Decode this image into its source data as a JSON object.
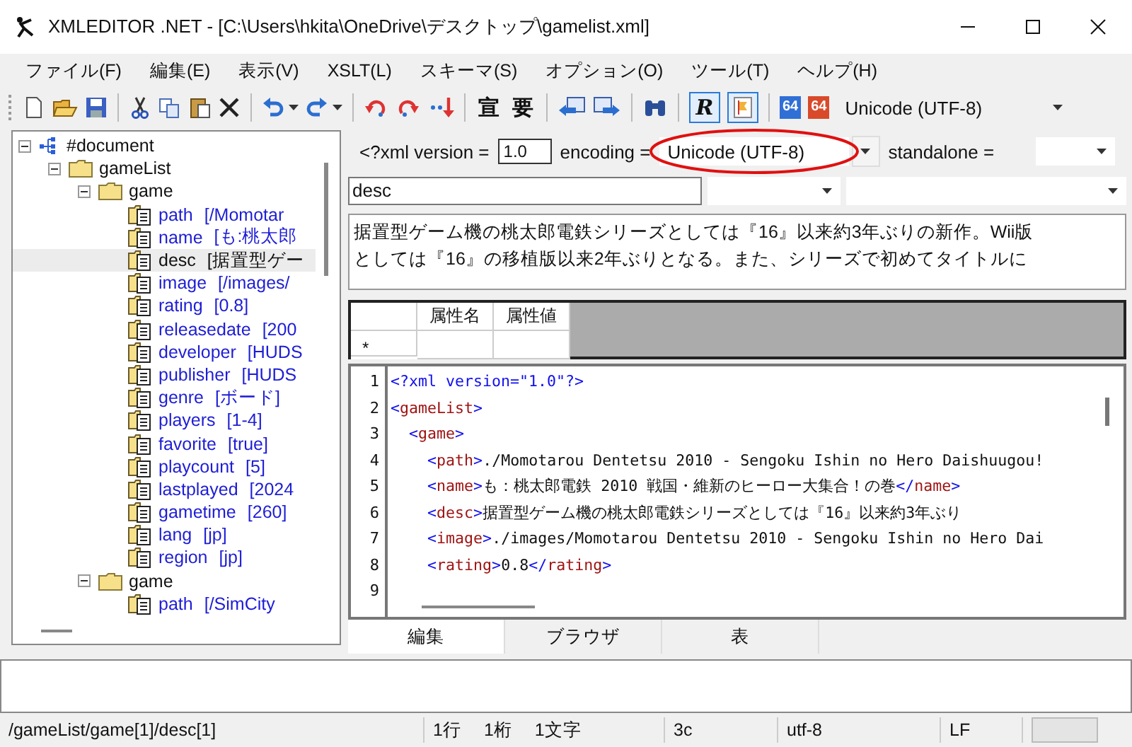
{
  "window": {
    "title": "XMLEDITOR .NET - [C:\\Users\\hkita\\OneDrive\\デスクトップ\\gamelist.xml]"
  },
  "menu": [
    "ファイル(F)",
    "編集(E)",
    "表示(V)",
    "XSLT(L)",
    "スキーマ(S)",
    "オプション(O)",
    "ツール(T)",
    "ヘルプ(H)"
  ],
  "toolbar": [
    {
      "kind": "new"
    },
    {
      "kind": "open"
    },
    {
      "kind": "save"
    },
    {
      "kind": "separator"
    },
    {
      "kind": "cut"
    },
    {
      "kind": "copy"
    },
    {
      "kind": "paste"
    },
    {
      "kind": "delete"
    },
    {
      "kind": "separator"
    },
    {
      "kind": "undo"
    },
    {
      "kind": "dropdown"
    },
    {
      "kind": "redo"
    },
    {
      "kind": "dropdown"
    },
    {
      "kind": "separator"
    },
    {
      "kind": "move-up"
    },
    {
      "kind": "move-down"
    },
    {
      "kind": "insert"
    },
    {
      "kind": "separator"
    },
    {
      "kind": "glyph",
      "text": "宣"
    },
    {
      "kind": "glyph",
      "text": "要"
    },
    {
      "kind": "separator"
    },
    {
      "kind": "left"
    },
    {
      "kind": "right"
    },
    {
      "kind": "separator"
    },
    {
      "kind": "find"
    },
    {
      "kind": "separator"
    },
    {
      "kind": "toggle-glyph",
      "text": "R",
      "selected": true
    },
    {
      "kind": "toggle-flag",
      "selected": true
    },
    {
      "kind": "separator"
    },
    {
      "kind": "badge",
      "text": "64",
      "color": "#2f6fd6"
    },
    {
      "kind": "badge",
      "text": "64",
      "color": "#d84a2a"
    },
    {
      "kind": "select",
      "text": "Unicode (UTF-8)"
    }
  ],
  "tree": [
    {
      "kind": "document",
      "label": "#document",
      "expanded": true,
      "selected": false,
      "children": [
        {
          "kind": "folder",
          "label": "gameList",
          "expanded": true,
          "selected": false,
          "children": [
            {
              "kind": "folder",
              "label": "game",
              "expanded": true,
              "selected": false,
              "children": [
                {
                  "kind": "field",
                  "label": "path",
                  "value": "[/Momotar",
                  "selected": false
                },
                {
                  "kind": "field",
                  "label": "name",
                  "value": "[も:桃太郎",
                  "selected": false
                },
                {
                  "kind": "field",
                  "label": "desc",
                  "value": "[据置型ゲー",
                  "selected": true
                },
                {
                  "kind": "field",
                  "label": "image",
                  "value": "[/images/",
                  "selected": false
                },
                {
                  "kind": "field",
                  "label": "rating",
                  "value": "[0.8]",
                  "selected": false
                },
                {
                  "kind": "field",
                  "label": "releasedate",
                  "value": "[200",
                  "selected": false
                },
                {
                  "kind": "field",
                  "label": "developer",
                  "value": "[HUDS",
                  "selected": false
                },
                {
                  "kind": "field",
                  "label": "publisher",
                  "value": "[HUDS",
                  "selected": false
                },
                {
                  "kind": "field",
                  "label": "genre",
                  "value": "[ボード]",
                  "selected": false
                },
                {
                  "kind": "field",
                  "label": "players",
                  "value": "[1-4]",
                  "selected": false
                },
                {
                  "kind": "field",
                  "label": "favorite",
                  "value": "[true]",
                  "selected": false
                },
                {
                  "kind": "field",
                  "label": "playcount",
                  "value": "[5]",
                  "selected": false
                },
                {
                  "kind": "field",
                  "label": "lastplayed",
                  "value": "[2024",
                  "selected": false
                },
                {
                  "kind": "field",
                  "label": "gametime",
                  "value": "[260]",
                  "selected": false
                },
                {
                  "kind": "field",
                  "label": "lang",
                  "value": "[jp]",
                  "selected": false
                },
                {
                  "kind": "field",
                  "label": "region",
                  "value": "[jp]",
                  "selected": false
                }
              ]
            },
            {
              "kind": "folder",
              "label": "game",
              "expanded": true,
              "selected": false,
              "children": [
                {
                  "kind": "field",
                  "label": "path",
                  "value": "[/SimCity",
                  "selected": false
                }
              ]
            }
          ]
        }
      ]
    }
  ],
  "declaration": {
    "version_label": "<?xml version =",
    "version": "1.0",
    "encoding_label": "encoding =",
    "encoding": "Unicode (UTF-8)",
    "encoding_circled": true,
    "standalone_label": "standalone ="
  },
  "element": {
    "name": "desc"
  },
  "content": [
    "据置型ゲーム機の桃太郎電鉄シリーズとしては『16』以来約3年ぶりの新作。Wii版",
    "としては『16』の移植版以来2年ぶりとなる。また、シリーズで初めてタイトルに"
  ],
  "attributes": {
    "columns": [
      "属性名",
      "属性値"
    ],
    "new_row_marker": "*"
  },
  "editor": {
    "lines": [
      {
        "number": "1",
        "text": "<?xml version=\"1.0\"?>"
      },
      {
        "number": "2",
        "text": "<gameList>"
      },
      {
        "number": "3",
        "text": "  <game>"
      },
      {
        "number": "4",
        "text": "    <path>./Momotarou Dentetsu 2010 - Sengoku Ishin no Hero Daishuugou!"
      },
      {
        "number": "5",
        "text": "    <name>も：桃太郎電鉄 2010 戦国・維新のヒーロー大集合！の巻</name>"
      },
      {
        "number": "6",
        "text": "    <desc>据置型ゲーム機の桃太郎電鉄シリーズとしては『16』以来約3年ぶり"
      },
      {
        "number": "7",
        "text": "    <image>./images/Momotarou Dentetsu 2010 - Sengoku Ishin no Hero Dai"
      },
      {
        "number": "8",
        "text": "    <rating>0.8</rating>"
      },
      {
        "number": "9"
      }
    ]
  },
  "tabs": [
    {
      "label": "編集",
      "selected": true
    },
    {
      "label": "ブラウザ",
      "selected": false
    },
    {
      "label": "表",
      "selected": false
    }
  ],
  "status_bar": {
    "path": "/gameList/game[1]/desc[1]",
    "line": "1行",
    "column": "1桁",
    "chars": "1文字",
    "code": "3c",
    "encoding": "utf-8",
    "newline": "LF"
  }
}
